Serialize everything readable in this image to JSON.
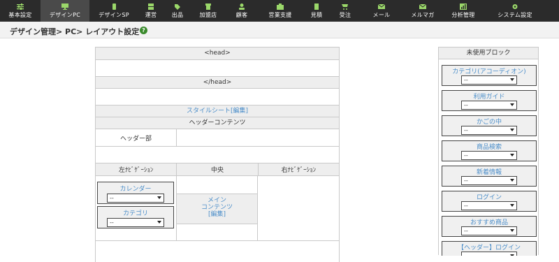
{
  "nav": {
    "items": [
      {
        "label": "基本設定",
        "icon": "sliders-icon"
      },
      {
        "label": "デザインPC",
        "icon": "monitor-icon"
      },
      {
        "label": "デザインSP",
        "icon": "smartphone-icon"
      },
      {
        "label": "運営",
        "icon": "server-icon"
      },
      {
        "label": "出品",
        "icon": "tag-icon"
      },
      {
        "label": "加盟店",
        "icon": "store-icon"
      },
      {
        "label": "顧客",
        "icon": "user-icon"
      },
      {
        "label": "営業支援",
        "icon": "briefcase-icon"
      },
      {
        "label": "見積",
        "icon": "document-icon"
      },
      {
        "label": "受注",
        "icon": "cart-icon"
      },
      {
        "label": "メール",
        "icon": "mail-icon"
      },
      {
        "label": "メルマガ",
        "icon": "newsletter-icon"
      },
      {
        "label": "分析管理",
        "icon": "chart-icon"
      },
      {
        "label": "システム設定",
        "icon": "gear-icon"
      }
    ]
  },
  "breadcrumb": {
    "title": "デザイン管理> PC> レイアウト設定",
    "help": "?"
  },
  "layout": {
    "head_open": "<head>",
    "head_close": "</head>",
    "stylesheet_link": "スタイルシート[編集]",
    "header_contents": "ヘッダーコンテンツ",
    "header_part": "ヘッダー部",
    "left_nav": "左ﾅﾋﾞｹﾞｰｼｮﾝ",
    "center": "中央",
    "right_nav": "右ﾅﾋﾞｹﾞｰｼｮﾝ",
    "left_blocks": [
      {
        "label": "カレンダー",
        "value": "--"
      },
      {
        "label": "カテゴリ",
        "value": "--"
      }
    ],
    "main_contents": {
      "line1": "メイン",
      "line2": "コンテンツ",
      "edit": "[編集]"
    }
  },
  "unused": {
    "title": "未使用ブロック",
    "blocks": [
      {
        "label": "カテゴリ(アコーディオン)",
        "value": "--"
      },
      {
        "label": "利用ガイド",
        "value": "--"
      },
      {
        "label": "かごの中",
        "value": "--"
      },
      {
        "label": "商品検索",
        "value": "--"
      },
      {
        "label": "新着情報",
        "value": "--"
      },
      {
        "label": "ログイン",
        "value": "--"
      },
      {
        "label": "おすすめ商品",
        "value": "--"
      },
      {
        "label": "【ヘッダー】ログイン",
        "value": "--"
      }
    ]
  },
  "colors": {
    "nav_bg": "#2b2b2b",
    "accent": "#3a8a2c",
    "link": "#4a8dc9"
  }
}
